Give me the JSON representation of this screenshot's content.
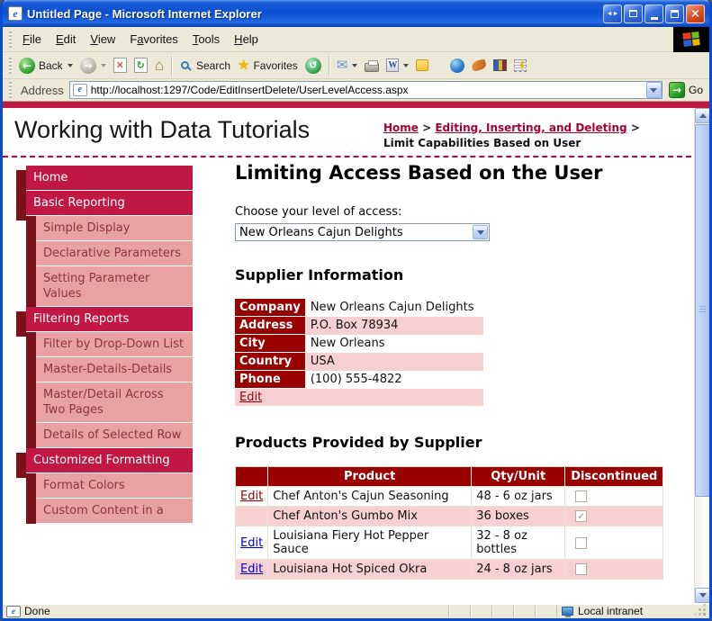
{
  "chrome": {
    "title": "Untitled Page - Microsoft Internet Explorer",
    "menu": [
      {
        "label": "File",
        "u": 0
      },
      {
        "label": "Edit",
        "u": 0
      },
      {
        "label": "View",
        "u": 0
      },
      {
        "label": "Favorites",
        "u": 1
      },
      {
        "label": "Tools",
        "u": 0
      },
      {
        "label": "Help",
        "u": 0
      }
    ],
    "toolbar": {
      "back": "Back",
      "search": "Search",
      "favorites": "Favorites"
    },
    "address": {
      "label": "Address",
      "value": "http://localhost:1297/Code/EditInsertDelete/UserLevelAccess.aspx",
      "go": "Go"
    },
    "status": {
      "done": "Done",
      "zone": "Local intranet"
    }
  },
  "page": {
    "site_title": "Working with Data Tutorials",
    "breadcrumb": {
      "separator": ">",
      "items": [
        {
          "label": "Home",
          "link": true
        },
        {
          "label": "Editing, Inserting, and Deleting",
          "link": true
        },
        {
          "label": "Limit Capabilities Based on User",
          "link": false
        }
      ]
    },
    "sidebar": [
      {
        "label": "Home",
        "level": 1
      },
      {
        "label": "Basic Reporting",
        "level": 1
      },
      {
        "label": "Simple Display",
        "level": 2
      },
      {
        "label": "Declarative Parameters",
        "level": 2
      },
      {
        "label": "Setting Parameter Values",
        "level": 2
      },
      {
        "label": "Filtering Reports",
        "level": 1
      },
      {
        "label": "Filter by Drop-Down List",
        "level": 2
      },
      {
        "label": "Master-Details-Details",
        "level": 2
      },
      {
        "label": "Master/Detail Across Two Pages",
        "level": 2
      },
      {
        "label": "Details of Selected Row",
        "level": 2
      },
      {
        "label": "Customized Formatting",
        "level": 1
      },
      {
        "label": "Format Colors",
        "level": 2
      },
      {
        "label": "Custom Content in a",
        "level": 2
      }
    ],
    "main": {
      "heading": "Limiting Access Based on the User",
      "access_label": "Choose your level of access:",
      "access_value": "New Orleans Cajun Delights",
      "supplier_heading": "Supplier Information",
      "supplier_rows": [
        {
          "label": "Company",
          "value": "New Orleans Cajun Delights"
        },
        {
          "label": "Address",
          "value": "P.O. Box 78934"
        },
        {
          "label": "City",
          "value": "New Orleans"
        },
        {
          "label": "Country",
          "value": "USA"
        },
        {
          "label": "Phone",
          "value": "(100) 555-4822"
        }
      ],
      "supplier_edit": "Edit",
      "products_heading": "Products Provided by Supplier",
      "products_headers": [
        "",
        "Product",
        "Qty/Unit",
        "Discontinued"
      ],
      "products_rows": [
        {
          "edit": "Edit",
          "edit_style": "visited",
          "product": "Chef Anton's Cajun Seasoning",
          "qty": "48 - 6 oz jars",
          "discontinued": false
        },
        {
          "edit": null,
          "edit_style": null,
          "product": "Chef Anton's Gumbo Mix",
          "qty": "36 boxes",
          "discontinued": true
        },
        {
          "edit": "Edit",
          "edit_style": "normal",
          "product": "Louisiana Fiery Hot Pepper Sauce",
          "qty": "32 - 8 oz bottles",
          "discontinued": false
        },
        {
          "edit": "Edit",
          "edit_style": "normal",
          "product": "Louisiana Hot Spiced Okra",
          "qty": "24 - 8 oz jars",
          "discontinued": false
        }
      ]
    }
  },
  "colors": {
    "crimson": "#c01843",
    "maroon": "#7d1119",
    "table_header": "#990000",
    "pink": "#f7d0d4",
    "sidebar_pink": "#e9a1a1",
    "link_blue": "#0000cc",
    "link_visited": "#990000"
  }
}
